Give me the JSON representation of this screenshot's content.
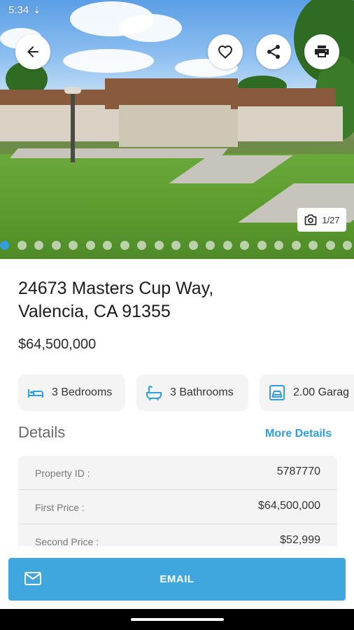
{
  "status_bar": {
    "time": "5:34",
    "download_icon": "download-arrow-icon"
  },
  "toolbar": {
    "back_icon": "arrow-left-icon",
    "favorite_icon": "heart-outline-icon",
    "share_icon": "share-icon",
    "print_icon": "printer-icon"
  },
  "gallery": {
    "counter": "1/27",
    "total_photos": 27,
    "current_index": 1,
    "dot_count": 21
  },
  "listing": {
    "address_line1": "24673 Masters Cup Way,",
    "address_line2": "Valencia, CA 91355",
    "price": "$64,500,000"
  },
  "features": [
    {
      "label": "3 Bedrooms",
      "icon": "bed-icon"
    },
    {
      "label": "3 Bathrooms",
      "icon": "bathtub-icon"
    },
    {
      "label": "2.00 Garag",
      "icon": "garage-car-icon"
    }
  ],
  "details": {
    "heading": "Details",
    "more_link": "More Details",
    "rows": [
      {
        "key": "Property ID :",
        "value": "5787770"
      },
      {
        "key": "First Price :",
        "value": "$64,500,000"
      },
      {
        "key": "Second Price :",
        "value": "$52,999"
      }
    ]
  },
  "actions": {
    "email_label": "EMAIL",
    "email_icon": "mail-icon"
  },
  "colors": {
    "accent": "#3fa7dd",
    "link": "#2f9fe0",
    "chip_bg": "#f4f4f4"
  }
}
